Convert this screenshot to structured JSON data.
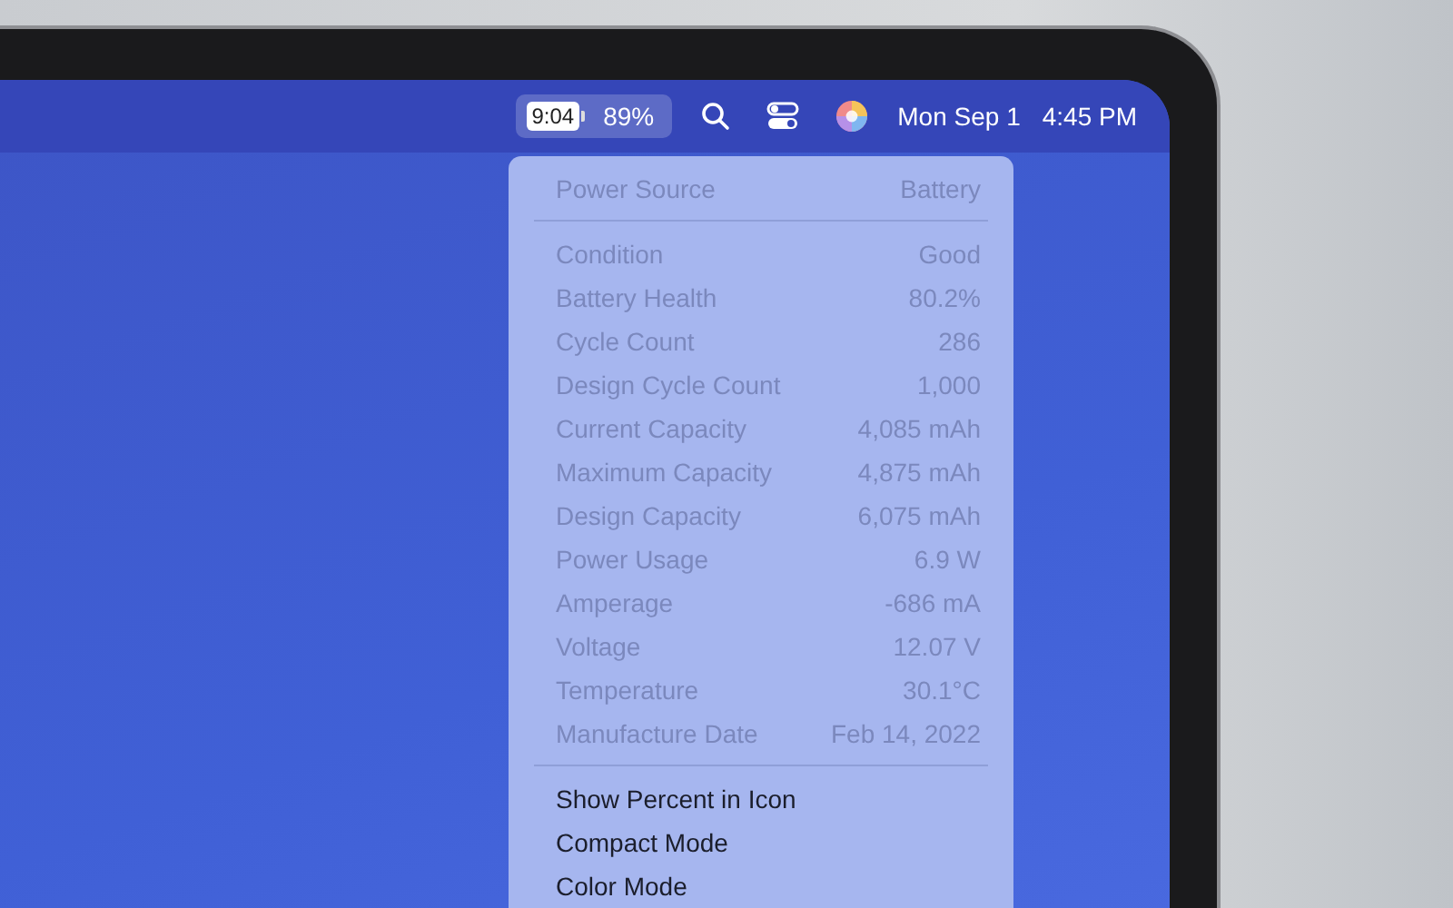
{
  "menu_bar": {
    "battery_time": "9:04",
    "battery_percent": "89%",
    "date": "Mon Sep 1",
    "time": "4:45 PM"
  },
  "battery_menu": {
    "header": {
      "label": "Power Source",
      "value": "Battery"
    },
    "details": [
      {
        "label": "Condition",
        "value": "Good"
      },
      {
        "label": "Battery Health",
        "value": "80.2%"
      },
      {
        "label": "Cycle Count",
        "value": "286"
      },
      {
        "label": "Design Cycle Count",
        "value": "1,000"
      },
      {
        "label": "Current Capacity",
        "value": "4,085 mAh"
      },
      {
        "label": "Maximum Capacity",
        "value": "4,875 mAh"
      },
      {
        "label": "Design Capacity",
        "value": "6,075 mAh"
      },
      {
        "label": "Power Usage",
        "value": "6.9 W"
      },
      {
        "label": "Amperage",
        "value": "-686 mA"
      },
      {
        "label": "Voltage",
        "value": "12.07 V"
      },
      {
        "label": "Temperature",
        "value": "30.1°C"
      },
      {
        "label": "Manufacture Date",
        "value": "Feb 14, 2022"
      }
    ],
    "actions": [
      {
        "label": "Show Percent in Icon"
      },
      {
        "label": "Compact Mode"
      },
      {
        "label": "Color Mode"
      }
    ]
  }
}
